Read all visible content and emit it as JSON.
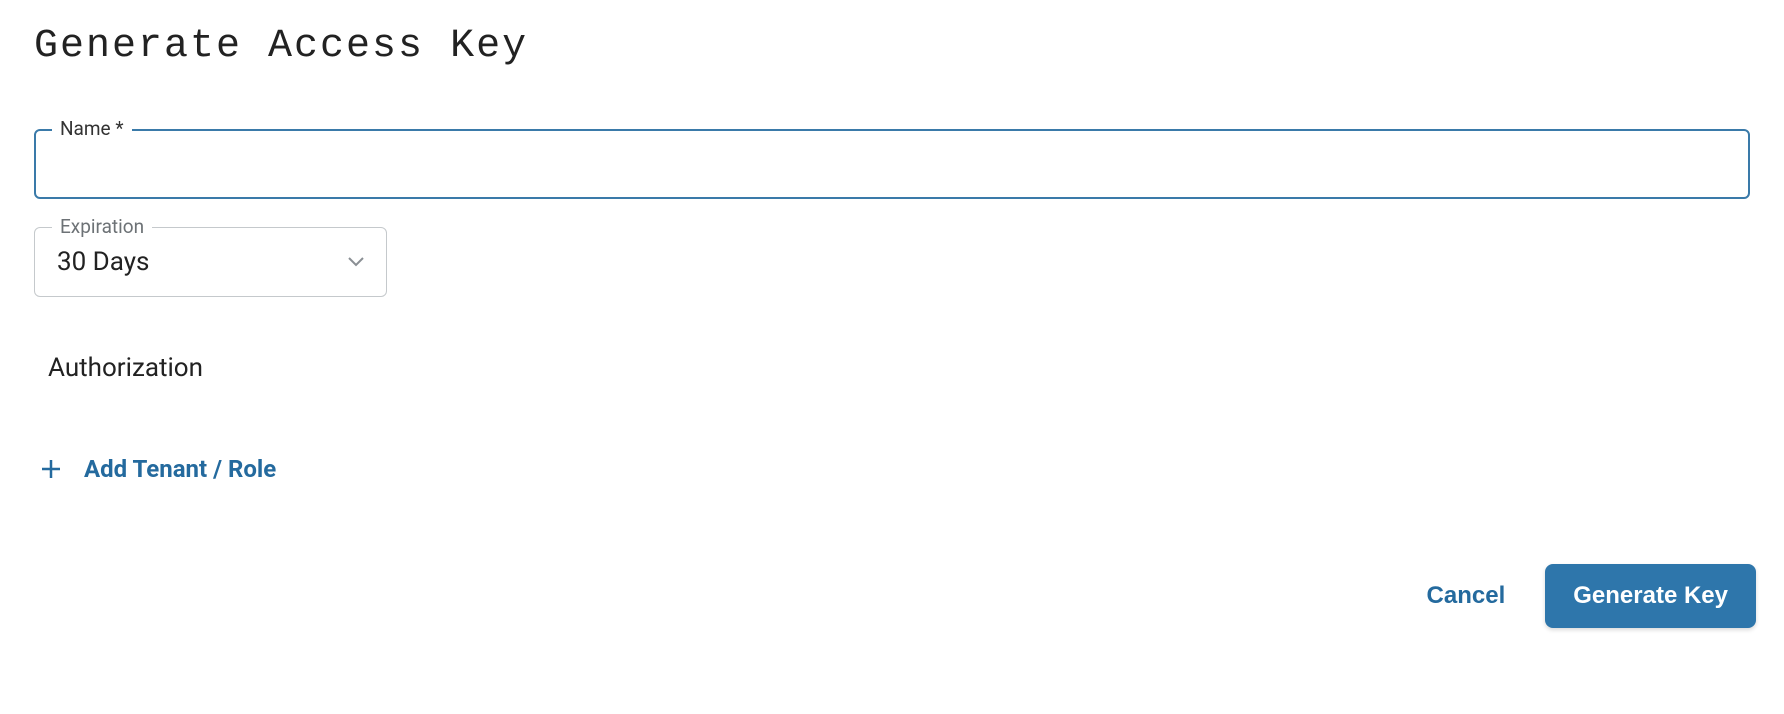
{
  "title": "Generate Access Key",
  "form": {
    "name": {
      "label": "Name *",
      "value": ""
    },
    "expiration": {
      "label": "Expiration",
      "selected": "30 Days"
    }
  },
  "authorization": {
    "heading": "Authorization",
    "add_label": "Add Tenant / Role"
  },
  "footer": {
    "cancel": "Cancel",
    "generate": "Generate Key"
  }
}
